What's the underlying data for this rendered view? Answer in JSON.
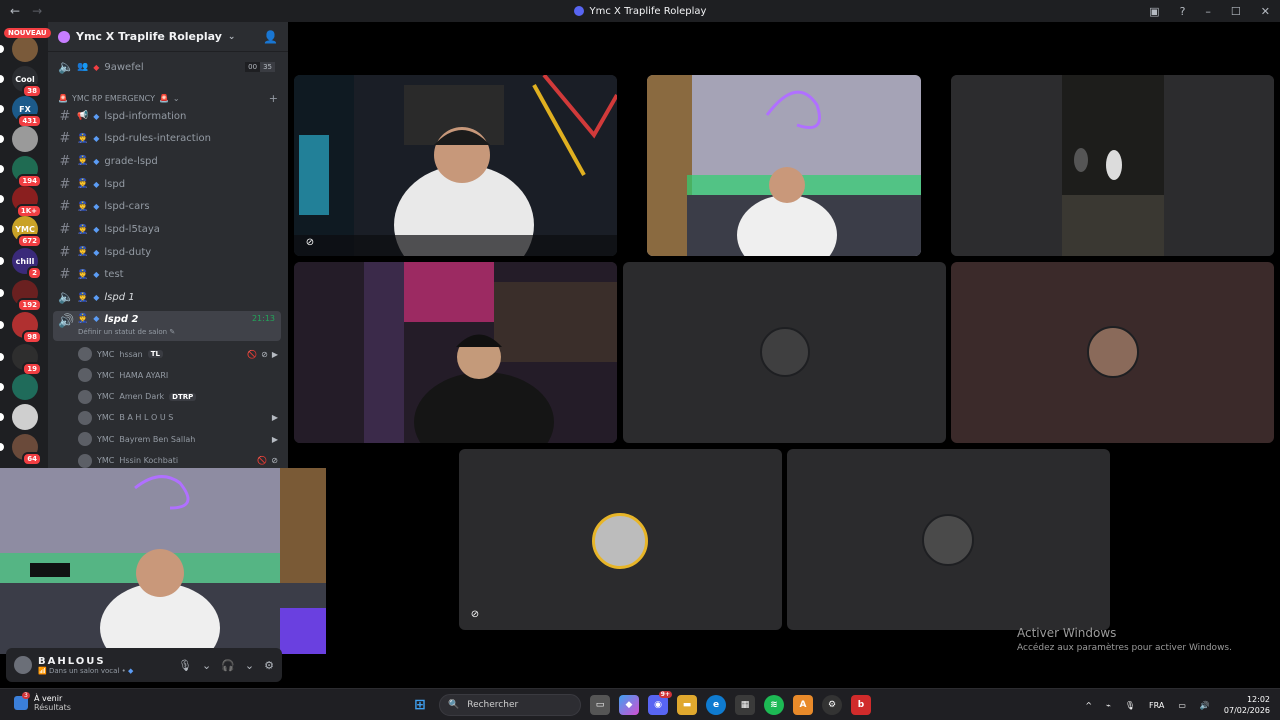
{
  "window": {
    "title": "Ymc X Traplife Roleplay"
  },
  "guilds": {
    "nouveau": "NOUVEAU",
    "items": [
      {
        "label": "",
        "badge": "",
        "color": "#7a5a3a"
      },
      {
        "label": "Cool",
        "badge": "38",
        "color": "#2b2d31"
      },
      {
        "label": "FX",
        "badge": "431",
        "color": "#1c5a8a"
      },
      {
        "label": "",
        "badge": "",
        "color": "#9a9a9a"
      },
      {
        "label": "",
        "badge": "194",
        "color": "#1f6b52"
      },
      {
        "label": "",
        "badge": "1K+",
        "color": "#8a1f1f"
      },
      {
        "label": "YMC",
        "badge": "672",
        "color": "#c9a227"
      },
      {
        "label": "chill",
        "badge": "2",
        "color": "#3a2a7a"
      },
      {
        "label": "",
        "badge": "192",
        "color": "#6a2020"
      },
      {
        "label": "",
        "badge": "98",
        "color": "#b03030"
      },
      {
        "label": "",
        "badge": "19",
        "color": "#2e2e2e"
      },
      {
        "label": "",
        "badge": "",
        "color": "#1f6b5a"
      },
      {
        "label": "",
        "badge": "",
        "color": "#cfcfcf"
      },
      {
        "label": "",
        "badge": "64",
        "color": "#6a4a3a"
      }
    ]
  },
  "server": {
    "name": "Ymc X Traplife Roleplay"
  },
  "top_voice": {
    "name": "9awefel",
    "count_left": "00",
    "count_right": "35"
  },
  "category": {
    "name": "YMC RP EMERGENCY"
  },
  "channels": [
    {
      "name": "lspd-information",
      "type": "text"
    },
    {
      "name": "lspd-rules-interaction",
      "type": "text"
    },
    {
      "name": "grade-lspd",
      "type": "text"
    },
    {
      "name": "lspd",
      "type": "text"
    },
    {
      "name": "lspd-cars",
      "type": "text"
    },
    {
      "name": "lspd-l5taya",
      "type": "text"
    },
    {
      "name": "lspd-duty",
      "type": "text"
    },
    {
      "name": "test",
      "type": "text"
    },
    {
      "name": "lspd 1",
      "type": "voice"
    }
  ],
  "active_voice": {
    "name": "lspd 2",
    "time": "21:13",
    "status": "Définir un statut de salon"
  },
  "voice_users": [
    {
      "prefix": "YMC",
      "name": "hssan",
      "badge": "TL"
    },
    {
      "prefix": "YMC",
      "name": "HAMA AYARI",
      "badge": ""
    },
    {
      "prefix": "YMC",
      "name": "Amen Dark",
      "badge": "DTRP"
    },
    {
      "prefix": "YMC",
      "name": "B A H L O U S",
      "badge": ""
    },
    {
      "prefix": "YMC",
      "name": "Bayrem Ben Sallah",
      "badge": ""
    },
    {
      "prefix": "YMC",
      "name": "Hssin Kochbati",
      "badge": ""
    }
  ],
  "user_panel": {
    "name": "BAHLOUS",
    "status": "Dans un salon vocal •"
  },
  "windows_watermark": {
    "line1": "Activer Windows",
    "line2": "Accédez aux paramètres pour activer Windows."
  },
  "taskbar": {
    "weather_line1": "À venir",
    "weather_line2": "Résultats",
    "weather_badge": "3",
    "search_placeholder": "Rechercher",
    "discord_badge": "9+",
    "lang": "FRA",
    "time": "12:02",
    "date": "07/02/2026"
  }
}
